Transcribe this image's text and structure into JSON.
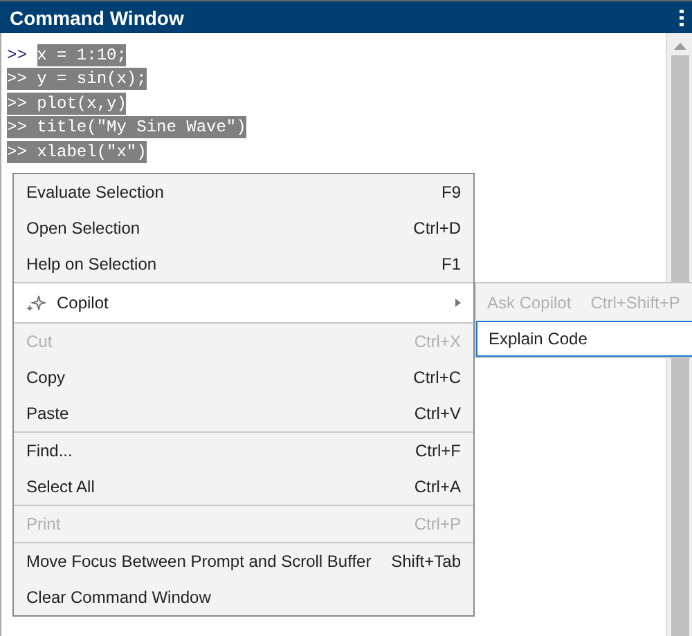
{
  "window": {
    "title": "Command Window"
  },
  "console": {
    "lines": [
      {
        "prompt": ">>",
        "code": "x = 1:10;",
        "selected": true,
        "prompt_selected": false
      },
      {
        "prompt": ">>",
        "code": "y = sin(x);",
        "selected": true,
        "prompt_selected": true
      },
      {
        "prompt": ">>",
        "code": "plot(x,y)",
        "selected": true,
        "prompt_selected": true
      },
      {
        "prompt": ">>",
        "code": "title(\"My Sine Wave\")",
        "selected": true,
        "prompt_selected": true
      },
      {
        "prompt": ">>",
        "code": "xlabel(\"x\")",
        "selected": true,
        "prompt_selected": true
      }
    ]
  },
  "context_menu": {
    "groups": [
      [
        {
          "kind": "command",
          "label": "Evaluate Selection",
          "shortcut": "F9",
          "disabled": false,
          "selected": false
        },
        {
          "kind": "command",
          "label": "Open Selection",
          "shortcut": "Ctrl+D",
          "disabled": false,
          "selected": false
        },
        {
          "kind": "command",
          "label": "Help on Selection",
          "shortcut": "F1",
          "disabled": false,
          "selected": false
        }
      ],
      [
        {
          "kind": "submenu",
          "label": "Copilot",
          "disabled": false,
          "selected": true
        }
      ],
      [
        {
          "kind": "command",
          "label": "Cut",
          "shortcut": "Ctrl+X",
          "disabled": true,
          "selected": false
        },
        {
          "kind": "command",
          "label": "Copy",
          "shortcut": "Ctrl+C",
          "disabled": false,
          "selected": false
        },
        {
          "kind": "command",
          "label": "Paste",
          "shortcut": "Ctrl+V",
          "disabled": false,
          "selected": false
        }
      ],
      [
        {
          "kind": "command",
          "label": "Find...",
          "shortcut": "Ctrl+F",
          "disabled": false,
          "selected": false
        },
        {
          "kind": "command",
          "label": "Select All",
          "shortcut": "Ctrl+A",
          "disabled": false,
          "selected": false
        }
      ],
      [
        {
          "kind": "command",
          "label": "Print",
          "shortcut": "Ctrl+P",
          "disabled": true,
          "selected": false
        }
      ],
      [
        {
          "kind": "command",
          "label": "Move Focus Between Prompt and Scroll Buffer",
          "shortcut": "Shift+Tab",
          "disabled": false,
          "selected": false
        },
        {
          "kind": "command",
          "label": "Clear Command Window",
          "disabled": false,
          "selected": false
        }
      ]
    ]
  },
  "submenu": {
    "items": [
      {
        "label": "Ask Copilot",
        "shortcut": "Ctrl+Shift+P",
        "disabled": true,
        "selected": false
      },
      {
        "label": "Explain Code",
        "disabled": false,
        "selected": true
      }
    ]
  }
}
